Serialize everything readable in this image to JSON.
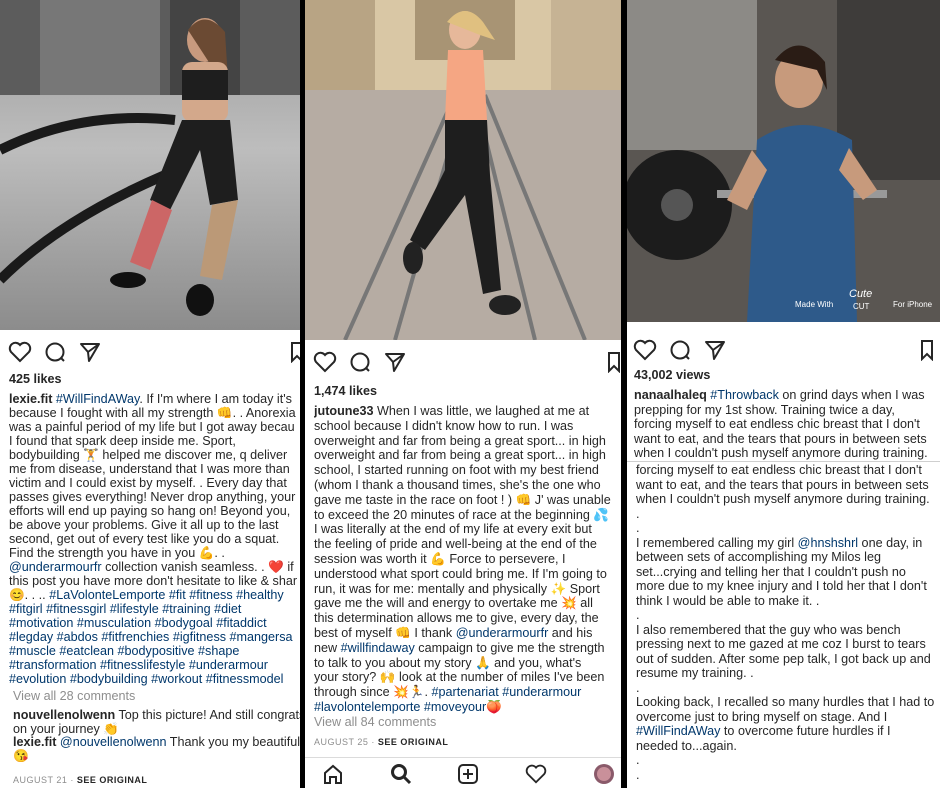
{
  "panel1": {
    "likes": "425 likes",
    "caption_lines": [
      [
        {
          "t": "lexie.fit",
          "c": "user"
        },
        {
          "t": " "
        },
        {
          "t": "#WillFindAWay",
          "c": "tag"
        },
        {
          "t": ". If I'm where I am today it's"
        }
      ],
      [
        {
          "t": "because I fought with all my strength 👊. . Anorexia"
        }
      ],
      [
        {
          "t": "was a painful period of my life but I got away becau"
        }
      ],
      [
        {
          "t": "I found that spark deep inside me. Sport,"
        }
      ],
      [
        {
          "t": "bodybuilding 🏋 helped me discover me, q deliver"
        }
      ],
      [
        {
          "t": "me from disease, understand that I was more than"
        }
      ],
      [
        {
          "t": "victim and I could exist by myself. . Every day that"
        }
      ],
      [
        {
          "t": "passes gives everything! Never drop anything, your"
        }
      ],
      [
        {
          "t": "efforts will end up paying so hang on! Beyond you,"
        }
      ],
      [
        {
          "t": "be above your problems. Give it all up to the last"
        }
      ],
      [
        {
          "t": "second, get out of every test like you do a squat."
        }
      ],
      [
        {
          "t": "Find the strength you have in you 💪. ."
        }
      ],
      [
        {
          "t": "@underarmourfr",
          "c": "tag"
        },
        {
          "t": " collection vanish seamless. . ❤️ if"
        }
      ],
      [
        {
          "t": "this post you have more don't hesitate to like & shar"
        }
      ],
      [
        {
          "t": "😊. . .. "
        },
        {
          "t": "#LaVolonteLemporte #fit #fitness #healthy",
          "c": "tag"
        }
      ],
      [
        {
          "t": "#fitgirl #fitnessgirl #lifestyle #training #diet",
          "c": "tag"
        }
      ],
      [
        {
          "t": "#motivation #musculation #bodygoal #fitaddict",
          "c": "tag"
        }
      ],
      [
        {
          "t": "#legday #abdos #fitfrenchies #igfitness #mangersa",
          "c": "tag"
        }
      ],
      [
        {
          "t": "#muscle #eatclean #bodypositive #shape",
          "c": "tag"
        }
      ],
      [
        {
          "t": "#transformation #fitnesslifestyle #underarmour",
          "c": "tag"
        }
      ],
      [
        {
          "t": "#evolution #bodybuilding #workout #fitnessmodel",
          "c": "tag"
        }
      ]
    ],
    "view_comments": "View all 28 comments",
    "comment_lines": [
      [
        {
          "t": "nouvellenolwenn",
          "c": "user"
        },
        {
          "t": " Top this picture! And still congrats"
        }
      ],
      [
        {
          "t": "on your journey 👏"
        }
      ],
      [
        {
          "t": "lexie.fit",
          "c": "user"
        },
        {
          "t": " "
        },
        {
          "t": "@nouvellenolwenn",
          "c": "tag"
        },
        {
          "t": " Thank you my beautiful"
        }
      ],
      [
        {
          "t": "😘"
        }
      ]
    ],
    "date": "AUGUST 21",
    "see_original": "SEE ORIGINAL"
  },
  "panel2": {
    "likes": "1,474 likes",
    "caption_lines": [
      [
        {
          "t": "jutoune33",
          "c": "user"
        },
        {
          "t": " When I was little, we laughed at me at"
        }
      ],
      [
        {
          "t": "school because I didn't know how to run. I was"
        }
      ],
      [
        {
          "t": "overweight and far from being a great sport... in high"
        }
      ],
      [
        {
          "t": "overweight and far from being a great sport... in high"
        }
      ],
      [
        {
          "t": "school, I started running on foot with my best friend"
        }
      ],
      [
        {
          "t": "(whom I thank a thousand times, she's the one who"
        }
      ],
      [
        {
          "t": "gave me taste in the race on foot ! ) 👊 J' was unable"
        }
      ],
      [
        {
          "t": "to exceed the 20 minutes of race at the beginning 💦"
        }
      ],
      [
        {
          "t": "I was literally at the end of my life at every exit but"
        }
      ],
      [
        {
          "t": "the feeling of pride and well-being at the end of the"
        }
      ],
      [
        {
          "t": "session was worth it 💪 Force to persevere, I"
        }
      ],
      [
        {
          "t": "understood what sport could bring me. If I'm going to"
        }
      ],
      [
        {
          "t": "run, it was for me: mentally and physically ✨ Sport"
        }
      ],
      [
        {
          "t": "gave me the will and energy to overtake me 💥 all"
        }
      ],
      [
        {
          "t": "this determination allows me to give, every day, the"
        }
      ],
      [
        {
          "t": "best of myself 👊 I thank "
        },
        {
          "t": "@underarmourfr",
          "c": "tag"
        },
        {
          "t": " and his"
        }
      ],
      [
        {
          "t": "new "
        },
        {
          "t": "#willfindaway",
          "c": "tag"
        },
        {
          "t": " campaign to give me the strength"
        }
      ],
      [
        {
          "t": "to talk to you about my story 🙏 and you, what's"
        }
      ],
      [
        {
          "t": "your story? 🙌 look at the number of miles I've been"
        }
      ],
      [
        {
          "t": "through since 💥🏃. "
        },
        {
          "t": "#partenariat #underarmour",
          "c": "tag"
        }
      ],
      [
        {
          "t": "#lavolontelemporte #moveyour",
          "c": "tag"
        },
        {
          "t": "🍑"
        }
      ]
    ],
    "view_comments": "View all 84 comments",
    "date": "AUGUST 25",
    "see_original": "SEE ORIGINAL"
  },
  "panel3": {
    "views": "43,002 views",
    "caption_lines": [
      [
        {
          "t": "nanaalhaleq",
          "c": "user"
        },
        {
          "t": " "
        },
        {
          "t": "#Throwback",
          "c": "tag"
        },
        {
          "t": " on grind days when I was"
        }
      ],
      [
        {
          "t": "prepping for my 1st show. Training twice a day,"
        }
      ],
      [
        {
          "t": "forcing myself to eat endless chic breast that I don't"
        }
      ],
      [
        {
          "t": "want to eat, and the tears that pours in between sets"
        }
      ],
      [
        {
          "t": "when I couldn't push myself anymore during training."
        }
      ]
    ],
    "continued_lines": [
      [
        {
          "t": "forcing myself to eat endless chic breast that I don't"
        }
      ],
      [
        {
          "t": "want to eat, and the tears that pours in between sets"
        }
      ],
      [
        {
          "t": "when I couldn't push myself anymore during training."
        }
      ],
      [
        {
          "t": "."
        }
      ],
      [
        {
          "t": "."
        }
      ],
      [
        {
          "t": "I remembered calling my girl "
        },
        {
          "t": "@hnshshrl",
          "c": "tag"
        },
        {
          "t": " one day, in"
        }
      ],
      [
        {
          "t": "between sets of accomplishing my Milos leg"
        }
      ],
      [
        {
          "t": "set...crying and telling her that I couldn't push no"
        }
      ],
      [
        {
          "t": "more due to my knee injury and I told her that I don't"
        }
      ],
      [
        {
          "t": "think I would be able to make it. ."
        }
      ],
      [
        {
          "t": "."
        }
      ],
      [
        {
          "t": "I also remembered that the guy who was bench"
        }
      ],
      [
        {
          "t": "pressing next to me gazed at me coz I burst to tears"
        }
      ],
      [
        {
          "t": "out of sudden. After some pep talk, I got back up and"
        }
      ],
      [
        {
          "t": "resume my training. ."
        }
      ],
      [
        {
          "t": "."
        }
      ],
      [
        {
          "t": "Looking back, I recalled so many hurdles that I had to"
        }
      ],
      [
        {
          "t": "overcome just to bring myself on stage. And I"
        }
      ],
      [
        {
          "t": "#WillFindAWay",
          "c": "tag"
        },
        {
          "t": " to overcome future hurdles if I"
        }
      ],
      [
        {
          "t": "needed to...again."
        }
      ],
      [
        {
          "t": "."
        }
      ],
      [
        {
          "t": "."
        }
      ]
    ],
    "watermark_made_with": "Made With",
    "watermark_cute": "Cute",
    "watermark_cut": "CUT",
    "watermark_iphone": "For iPhone"
  },
  "colors": {
    "link": "#00376b",
    "muted": "#8e8e8e",
    "text": "#262626"
  },
  "icons": [
    "heart-icon",
    "comment-icon",
    "share-icon",
    "bookmark-icon",
    "home-icon",
    "search-icon",
    "add-post-icon",
    "activity-heart-icon",
    "profile-avatar-icon"
  ]
}
